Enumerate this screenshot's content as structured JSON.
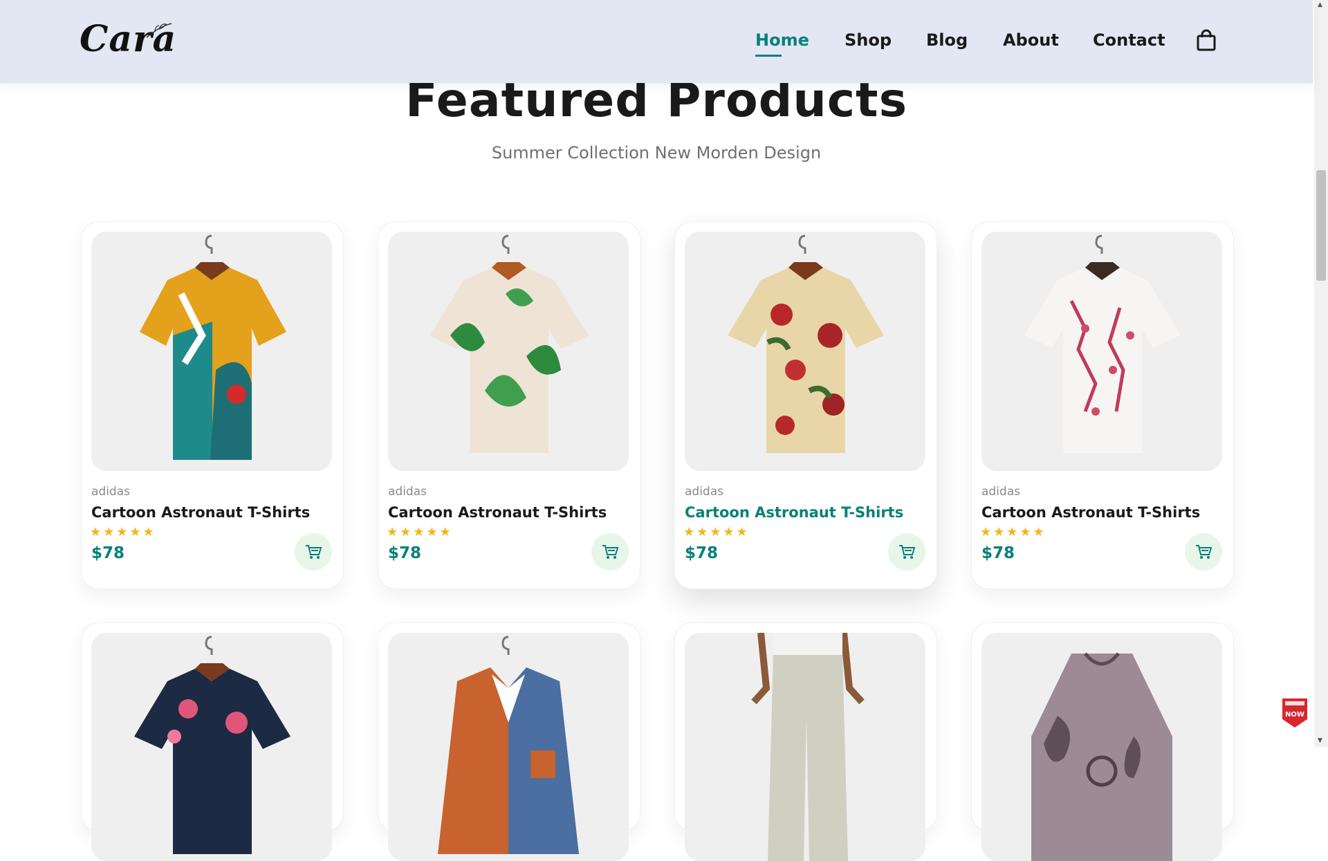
{
  "header": {
    "logo": "Cara",
    "nav": [
      {
        "label": "Home",
        "active": true
      },
      {
        "label": "Shop",
        "active": false
      },
      {
        "label": "Blog",
        "active": false
      },
      {
        "label": "About",
        "active": false
      },
      {
        "label": "Contact",
        "active": false
      }
    ],
    "cart_icon": "shopping-bag-icon"
  },
  "section": {
    "title": "Featured Products",
    "subtitle": "Summer Collection New Morden Design"
  },
  "products": [
    {
      "brand": "adidas",
      "name": "Cartoon Astronaut T-Shirts",
      "stars": "★★★★★",
      "price": "$78"
    },
    {
      "brand": "adidas",
      "name": "Cartoon Astronaut T-Shirts",
      "stars": "★★★★★",
      "price": "$78"
    },
    {
      "brand": "adidas",
      "name": "Cartoon Astronaut T-Shirts",
      "stars": "★★★★★",
      "price": "$78"
    },
    {
      "brand": "adidas",
      "name": "Cartoon Astronaut T-Shirts",
      "stars": "★★★★★",
      "price": "$78"
    }
  ],
  "colors": {
    "accent": "#088178",
    "header_bg": "#e3e6f3",
    "star": "#f3b519",
    "cart_btn_bg": "#e8f6ea"
  },
  "badge": {
    "text": "NOW"
  }
}
